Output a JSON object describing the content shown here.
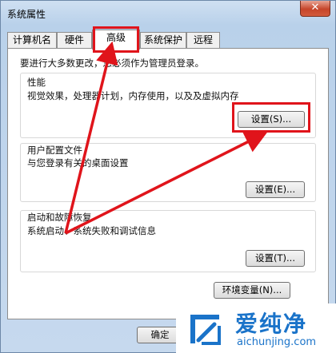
{
  "window": {
    "title": "系统属性",
    "close_glyph": "✕"
  },
  "tabs": [
    {
      "label": "计算机名"
    },
    {
      "label": "硬件"
    },
    {
      "label": "高级"
    },
    {
      "label": "系统保护"
    },
    {
      "label": "远程"
    }
  ],
  "advanced": {
    "notice": "要进行大多数更改，您必须作为管理员登录。",
    "performance": {
      "title": "性能",
      "desc": "视觉效果，处理器计划，内存使用，以及及虚拟内存",
      "button": "设置(S)..."
    },
    "profile": {
      "title": "用户配置文件",
      "desc": "与您登录有关的桌面设置",
      "button": "设置(E)..."
    },
    "startup": {
      "title": "启动和故障恢复",
      "desc": "系统启动、系统失败和调试信息",
      "button": "设置(T)..."
    },
    "env_button": "环境变量(N)..."
  },
  "footer": {
    "ok_label": "确定"
  },
  "watermark": {
    "name": "爱纯净",
    "url": "aichunjing.com"
  },
  "colors": {
    "annotation": "#e0141b",
    "brand": "#1a73c9"
  }
}
